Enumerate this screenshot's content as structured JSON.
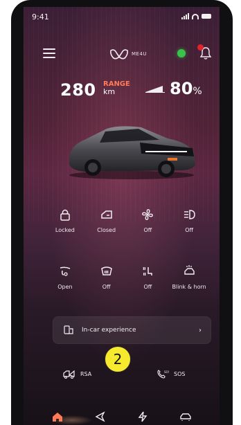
{
  "status_bar": {
    "time": "9:41"
  },
  "header": {
    "logo_text": "ME4U",
    "status_dot_color": "#38c44a",
    "notification_badge_color": "#e0242b"
  },
  "stats": {
    "range_value": "280",
    "range_label": "RANGE",
    "range_unit": "km",
    "battery_value": "80",
    "battery_unit": "%"
  },
  "controls_row1": [
    {
      "label": "Locked",
      "icon": "lock-icon"
    },
    {
      "label": "Closed",
      "icon": "car-door-icon"
    },
    {
      "label": "Off",
      "icon": "fan-icon"
    },
    {
      "label": "Off",
      "icon": "headlight-icon"
    }
  ],
  "controls_row2": [
    {
      "label": "Open",
      "icon": "sunroof-icon"
    },
    {
      "label": "Off",
      "icon": "defrost-icon"
    },
    {
      "label": "Off",
      "icon": "seat-heater-icon"
    },
    {
      "label": "Blink & horn",
      "icon": "blink-horn-icon"
    }
  ],
  "card": {
    "label": "In-car experience",
    "chevron": "›"
  },
  "quick_actions": {
    "rsa": "RSA",
    "sos": "SOS"
  },
  "annotation": {
    "number": "2"
  },
  "bottom_nav": [
    "home-icon",
    "navigate-icon",
    "charge-icon",
    "car-icon"
  ],
  "colors": {
    "accent_orange": "#ff7a56",
    "highlight": "#f7ea2e"
  }
}
